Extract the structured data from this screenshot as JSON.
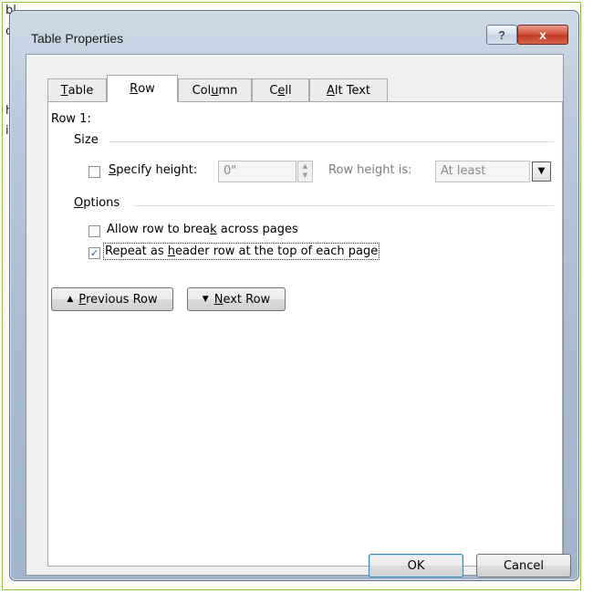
{
  "background_doc": {
    "lines": [
      "bl",
      "ct",
      "he",
      "i"
    ]
  },
  "dialog": {
    "title": "Table Properties",
    "help_glyph": "?",
    "close_glyph": "x"
  },
  "tabs": [
    {
      "label": "Table",
      "mnemonic": "T",
      "rest": "able",
      "active": false
    },
    {
      "label": "Row",
      "mnemonic": "R",
      "rest": "ow",
      "active": true
    },
    {
      "label": "Column",
      "pre": "Col",
      "mnemonic": "u",
      "rest": "mn",
      "active": false
    },
    {
      "label": "Cell",
      "pre": "C",
      "mnemonic": "e",
      "rest": "ll",
      "active": false
    },
    {
      "label": "Alt Text",
      "mnemonic": "A",
      "rest": "lt Text",
      "active": false
    }
  ],
  "row_tab": {
    "row_heading": "Row 1:",
    "size_label": "Size",
    "specify_height": {
      "mnemonic": "S",
      "rest": "pecify height:",
      "checked": false
    },
    "height_value": "0\"",
    "row_height_is_label": "Row height is:",
    "row_height_mode": "At least",
    "options_label": {
      "mnemonic": "O",
      "rest": "ptions"
    },
    "allow_break": {
      "pre": "Allow row to brea",
      "mnemonic": "k",
      "rest": " across pages",
      "checked": false
    },
    "repeat_header": {
      "pre": "Repeat as ",
      "mnemonic": "h",
      "rest": "eader row at the top of each page",
      "checked": true
    },
    "check_glyph": "✓",
    "previous_row": {
      "mnemonic": "P",
      "rest": "revious Row"
    },
    "next_row": {
      "mnemonic": "N",
      "rest": "ext Row"
    },
    "up_glyph": "▲",
    "down_glyph": "▼"
  },
  "footer": {
    "ok_label": "OK",
    "cancel_label": "Cancel"
  },
  "colors": {
    "frame_accent": "#8cc63f",
    "close_button": "#c23b22",
    "default_button_border": "#3c7fb1"
  }
}
